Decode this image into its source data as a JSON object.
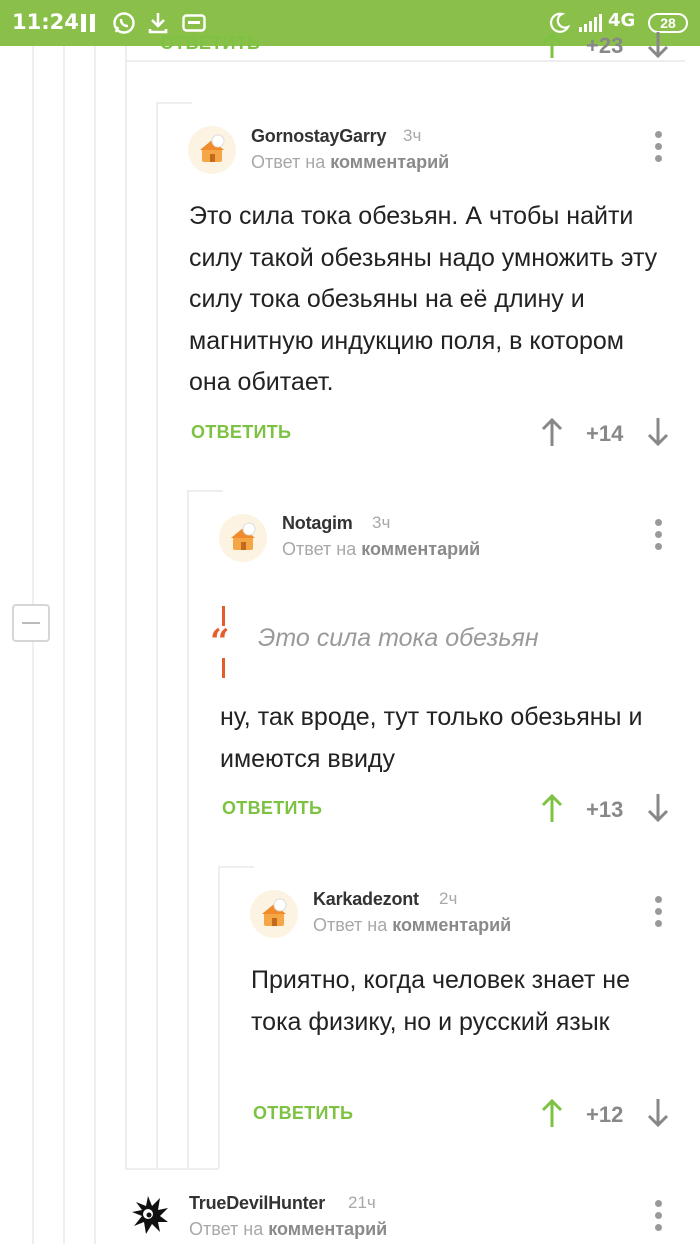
{
  "status_bar": {
    "time": "11:24",
    "network": "4G",
    "battery": "28"
  },
  "top_partial": {
    "reply_label": "ОТВЕТИТЬ",
    "rating": "+23"
  },
  "comments": [
    {
      "username": "GornostayGarry",
      "time": "3ч",
      "reply_prefix": "Ответ на",
      "reply_link": "комментарий",
      "text": "Это сила тока обезьян. А чтобы найти силу такой обезьяны надо умножить эту силу тока обезьяны на её длину и магнитную индукцию поля, в котором она обитает.",
      "reply_label": "ОТВЕТИТЬ",
      "rating": "+14"
    },
    {
      "username": "Notagim",
      "time": "3ч",
      "reply_prefix": "Ответ на",
      "reply_link": "комментарий",
      "quote": "Это сила тока обезьян",
      "text": "ну, так вроде, тут только обезьяны и имеются ввиду",
      "reply_label": "ОТВЕТИТЬ",
      "rating": "+13"
    },
    {
      "username": "Karkadezont",
      "time": "2ч",
      "reply_prefix": "Ответ на",
      "reply_link": "комментарий",
      "text": "Приятно, когда человек знает не тока физику, но и русский язык",
      "reply_label": "ОТВЕТИТЬ",
      "rating": "+12"
    },
    {
      "username": "TrueDevilHunter",
      "time": "21ч",
      "reply_prefix": "Ответ на",
      "reply_link": "комментарий"
    }
  ],
  "colors": {
    "status_bar": "#8ac04a",
    "accent_green": "#7dc242",
    "quote_orange": "#e65c2d"
  }
}
